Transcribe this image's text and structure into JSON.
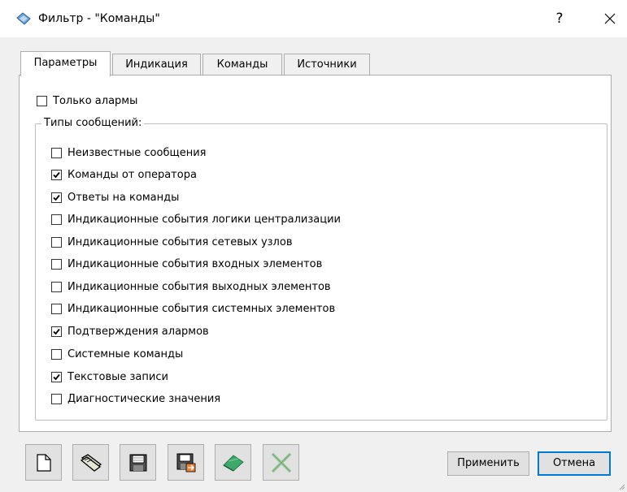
{
  "window": {
    "title": "Фильтр - \"Команды\"",
    "help_label": "?"
  },
  "tabs": [
    {
      "label": "Параметры",
      "active": true
    },
    {
      "label": "Индикация",
      "active": false
    },
    {
      "label": "Команды",
      "active": false
    },
    {
      "label": "Источники",
      "active": false
    }
  ],
  "only_alarms": {
    "label": "Только алармы",
    "checked": false
  },
  "message_types": {
    "group_label": "Типы сообщений:",
    "items": [
      {
        "label": "Неизвестные сообщения",
        "checked": false
      },
      {
        "label": "Команды от оператора",
        "checked": true
      },
      {
        "label": "Ответы на команды",
        "checked": true
      },
      {
        "label": "Индикационные события логики централизации",
        "checked": false
      },
      {
        "label": "Индикационные события сетевых узлов",
        "checked": false
      },
      {
        "label": "Индикационные события входных элементов",
        "checked": false
      },
      {
        "label": "Индикационные события выходных элементов",
        "checked": false
      },
      {
        "label": "Индикационные события системных элементов",
        "checked": false
      },
      {
        "label": "Подтверждения алармов",
        "checked": true
      },
      {
        "label": "Системные команды",
        "checked": false
      },
      {
        "label": "Текстовые записи",
        "checked": true
      },
      {
        "label": "Диагностические значения",
        "checked": false
      }
    ]
  },
  "toolbar": {
    "icons": [
      "new-file-icon",
      "open-folder-icon",
      "save-icon",
      "save-as-icon",
      "eraser-icon",
      "delete-x-icon"
    ]
  },
  "buttons": {
    "apply_label": "Применить",
    "cancel_label": "Отмена"
  },
  "colors": {
    "eraser_green": "#3ea86a",
    "delete_green": "#9fc89f",
    "default_button_border": "#0078d7"
  }
}
